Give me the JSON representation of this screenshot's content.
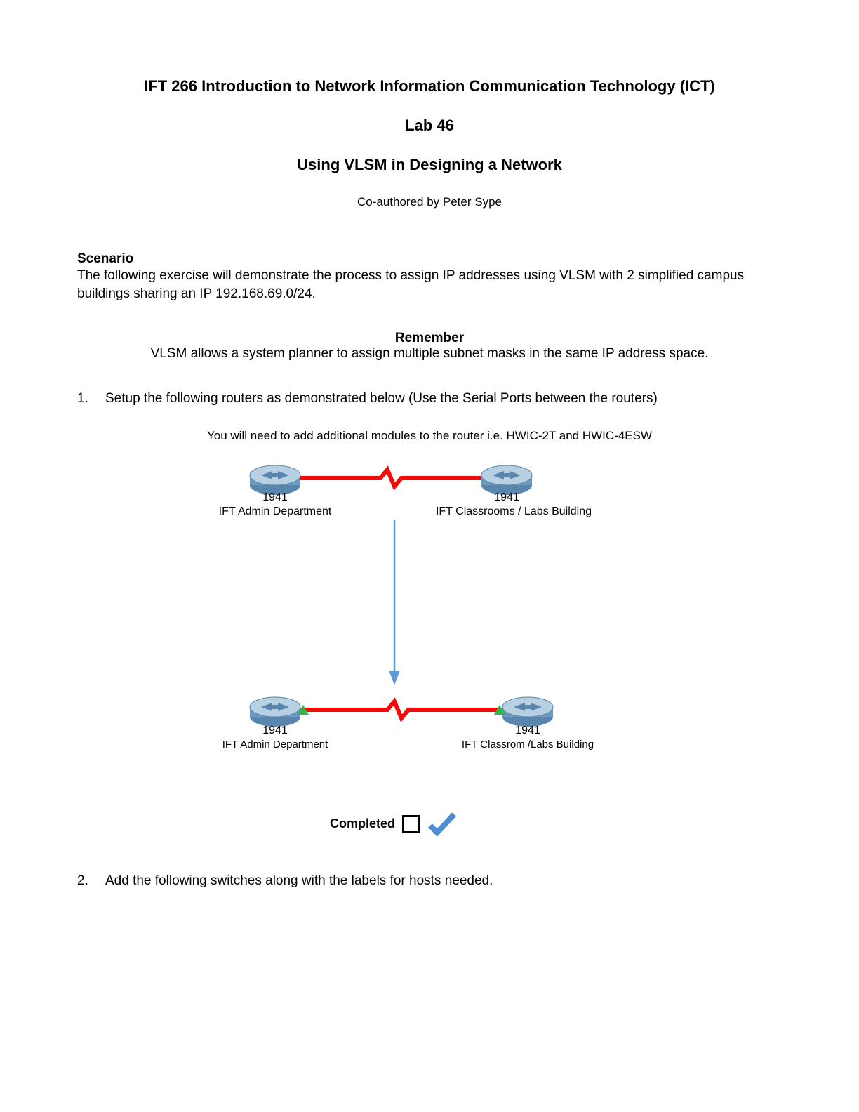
{
  "header": {
    "course_title": "IFT 266 Introduction to Network Information Communication Technology (ICT)",
    "lab_number": "Lab 46",
    "lab_title": "Using VLSM in Designing a Network",
    "author": "Co-authored by Peter Sype"
  },
  "scenario": {
    "heading": "Scenario",
    "body": "The following exercise will demonstrate the process to assign IP addresses using VLSM with 2 simplified campus buildings sharing an IP 192.168.69.0/24."
  },
  "remember": {
    "heading": "Remember",
    "body": "VLSM allows a system planner to assign multiple subnet masks in the same IP address space."
  },
  "steps": {
    "s1_num": "1.",
    "s1_text": "Setup the following routers as demonstrated below (Use the Serial Ports between the routers)",
    "s1_hint": "You will need to add additional modules to the router i.e. HWIC-2T and HWIC-4ESW",
    "s2_num": "2.",
    "s2_text": "Add the following switches along with the labels for hosts needed."
  },
  "diagram": {
    "router_model": "1941",
    "top_left_label": "IFT Admin Department",
    "top_right_label": "IFT Classrooms / Labs Building",
    "bottom_left_label": "IFT Admin Department",
    "bottom_right_label": "IFT Classrom /Labs Building"
  },
  "completed": {
    "label": "Completed"
  },
  "colors": {
    "link_red": "#f40808",
    "arrow_blue": "#5a9ad6",
    "check_blue": "#4f8bd1",
    "router_blue": "#6c9bc4",
    "router_top": "#b7d1e3"
  }
}
